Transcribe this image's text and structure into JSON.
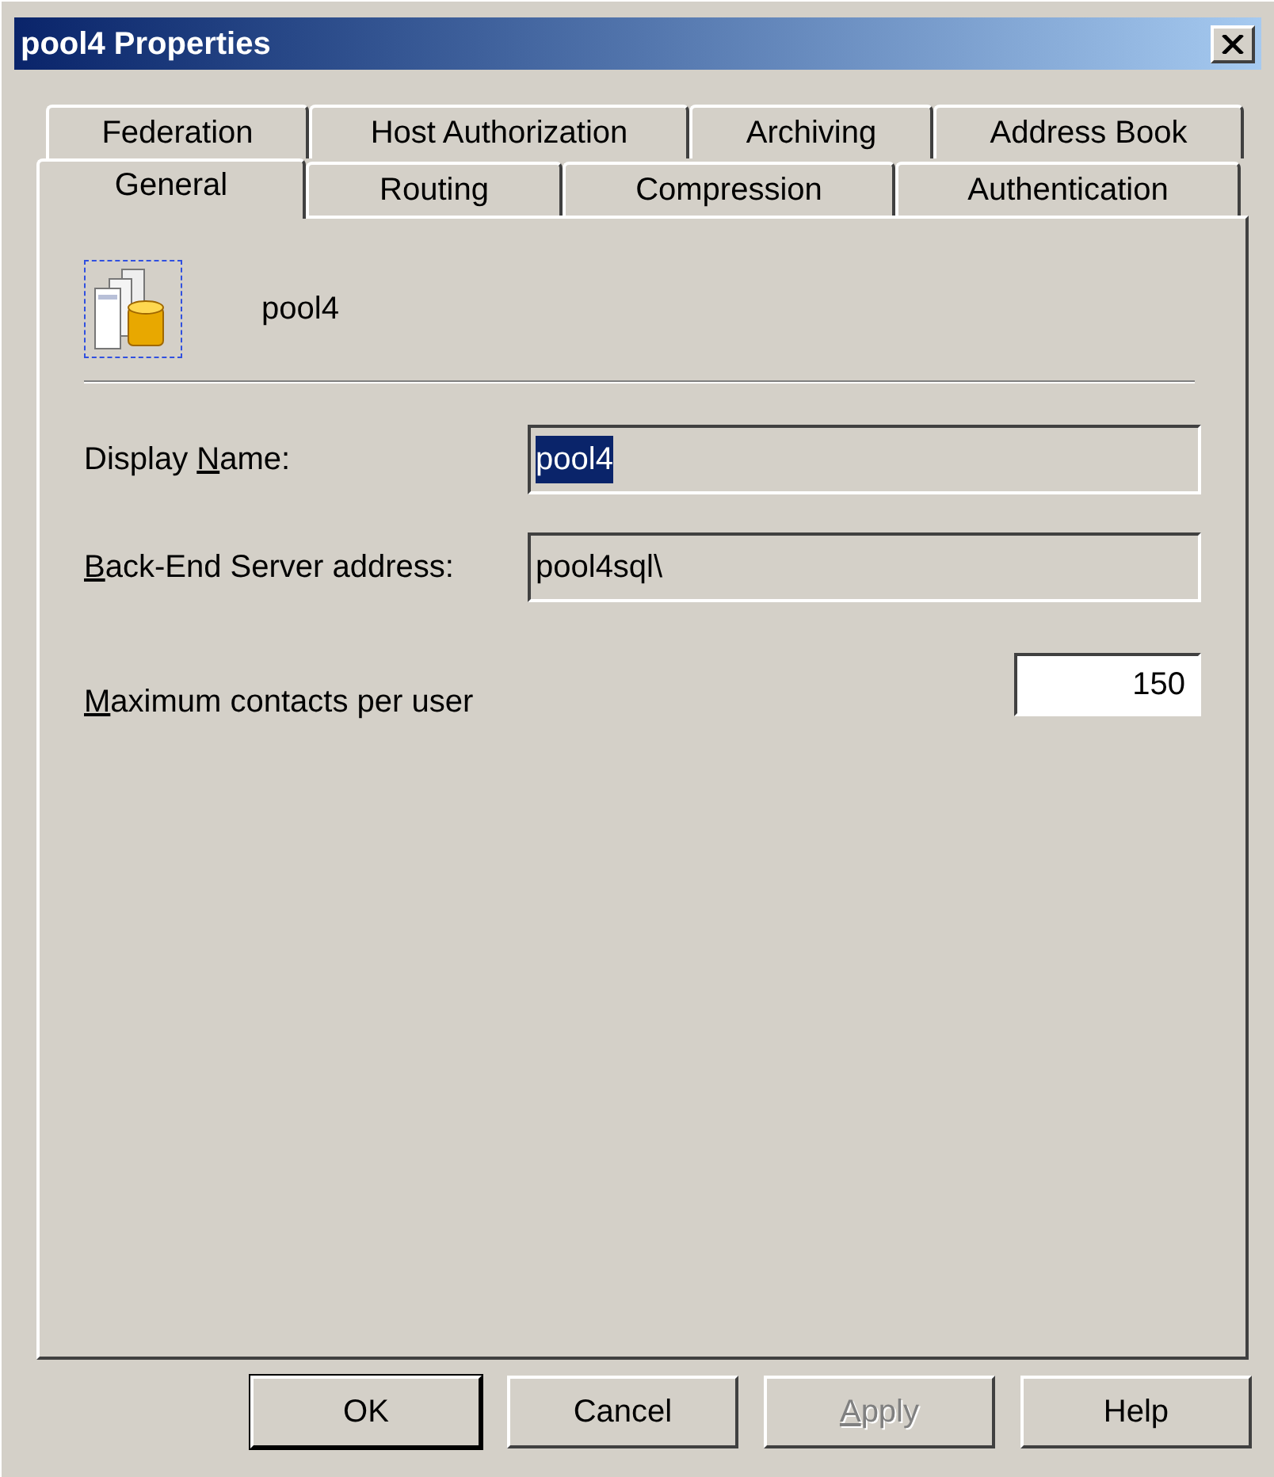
{
  "window": {
    "title": "pool4 Properties"
  },
  "tab_rows": [
    [
      {
        "label": "Federation",
        "selected": false
      },
      {
        "label": "Host Authorization",
        "selected": false
      },
      {
        "label": "Archiving",
        "selected": false
      },
      {
        "label": "Address Book",
        "selected": false
      }
    ],
    [
      {
        "label": "General",
        "selected": true
      },
      {
        "label": "Routing",
        "selected": false
      },
      {
        "label": "Compression",
        "selected": false
      },
      {
        "label": "Authentication",
        "selected": false
      }
    ]
  ],
  "header": {
    "name": "pool4"
  },
  "fields": [
    {
      "label": {
        "before": "Display ",
        "key": "N",
        "after": "ame:"
      },
      "value": "pool4",
      "selected_text": true,
      "kind": "wide"
    },
    {
      "label": {
        "key": "B",
        "after": "ack-End Server address:"
      },
      "value": "pool4sql\\",
      "selected_text": false,
      "kind": "wide"
    },
    {
      "label": {
        "key": "M",
        "after": "aximum contacts per user"
      },
      "value": "150",
      "selected_text": false,
      "kind": "number"
    }
  ],
  "buttons": [
    {
      "label": {
        "before": "OK"
      },
      "disabled": false,
      "default": true
    },
    {
      "label": {
        "before": "Cancel"
      },
      "disabled": false,
      "default": false
    },
    {
      "label": {
        "key": "A",
        "after": "pply"
      },
      "disabled": true,
      "default": false
    },
    {
      "label": {
        "before": "Help"
      },
      "disabled": false,
      "default": false
    }
  ]
}
